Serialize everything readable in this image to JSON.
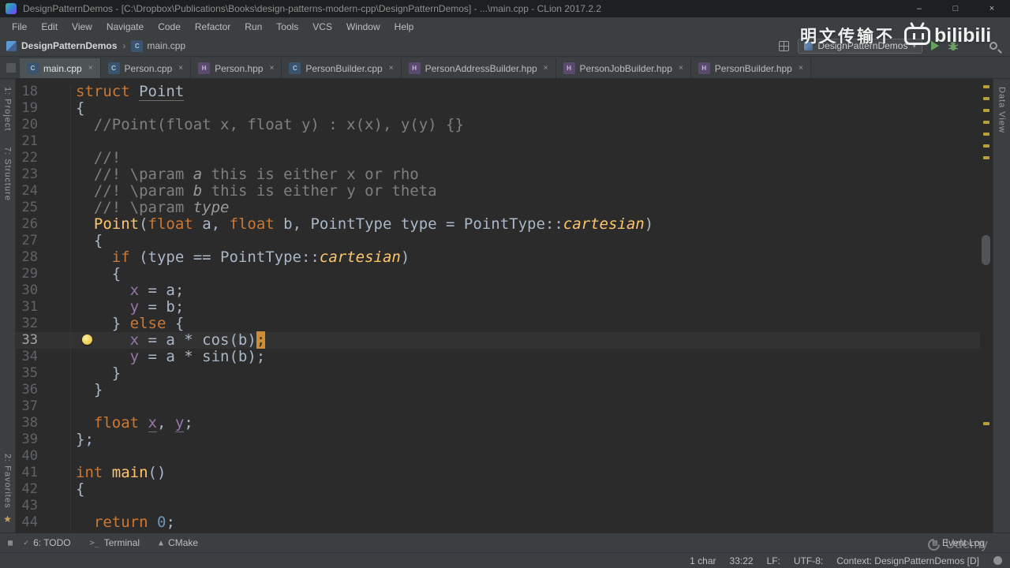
{
  "window": {
    "title": "DesignPatternDemos - [C:\\Dropbox\\Publications\\Books\\design-patterns-modern-cpp\\DesignPatternDemos] - ...\\main.cpp - CLion 2017.2.2",
    "controls": {
      "minimize": "–",
      "maximize": "□",
      "close": "×"
    }
  },
  "menu": [
    "File",
    "Edit",
    "View",
    "Navigate",
    "Code",
    "Refactor",
    "Run",
    "Tools",
    "VCS",
    "Window",
    "Help"
  ],
  "breadcrumb": {
    "project": "DesignPatternDemos",
    "file": "main.cpp"
  },
  "toolbar": {
    "run_config": "DesignPatternDemos"
  },
  "glyphs": {
    "close": "×",
    "chevron": "▾",
    "breadcrumb_sep": "›",
    "star": "★",
    "event": "▤",
    "toggler": "▦"
  },
  "file_icon_glyphs": {
    "cpp": "C",
    "hpp": "H"
  },
  "tabs": [
    {
      "label": "main.cpp",
      "kind": "cpp",
      "active": true
    },
    {
      "label": "Person.cpp",
      "kind": "cpp"
    },
    {
      "label": "Person.hpp",
      "kind": "hpp"
    },
    {
      "label": "PersonBuilder.cpp",
      "kind": "cpp"
    },
    {
      "label": "PersonAddressBuilder.hpp",
      "kind": "hpp"
    },
    {
      "label": "PersonJobBuilder.hpp",
      "kind": "hpp"
    },
    {
      "label": "PersonBuilder.hpp",
      "kind": "hpp"
    }
  ],
  "stripes": {
    "left_top": [
      "1: Project",
      "7: Structure"
    ],
    "left_bottom": [
      "2: Favorites"
    ],
    "right": [
      "Data View"
    ]
  },
  "editor": {
    "caret_line": 33,
    "error_stripe_marks": [
      8,
      23,
      38,
      53,
      68,
      83,
      98,
      435
    ],
    "lines": [
      {
        "no": 18,
        "tokens": [
          [
            "kw",
            "struct"
          ],
          [
            "pl",
            " "
          ],
          [
            "clsu",
            "Point"
          ]
        ]
      },
      {
        "no": 19,
        "tokens": [
          [
            "pl",
            "{"
          ]
        ]
      },
      {
        "no": 20,
        "tokens": [
          [
            "pl",
            "  "
          ],
          [
            "cm",
            "//Point(float x, float y) : x(x), y(y) {}"
          ]
        ]
      },
      {
        "no": 21,
        "tokens": []
      },
      {
        "no": 22,
        "tokens": [
          [
            "pl",
            "  "
          ],
          [
            "cm",
            "//!"
          ]
        ]
      },
      {
        "no": 23,
        "tokens": [
          [
            "pl",
            "  "
          ],
          [
            "cm",
            "//! \\param "
          ],
          [
            "cmi",
            "a"
          ],
          [
            "cm",
            " this is either x or rho"
          ]
        ]
      },
      {
        "no": 24,
        "tokens": [
          [
            "pl",
            "  "
          ],
          [
            "cm",
            "//! \\param "
          ],
          [
            "cmi",
            "b"
          ],
          [
            "cm",
            " this is either y or theta"
          ]
        ]
      },
      {
        "no": 25,
        "tokens": [
          [
            "pl",
            "  "
          ],
          [
            "cm",
            "//! \\param "
          ],
          [
            "cmi",
            "type"
          ]
        ]
      },
      {
        "no": 26,
        "tokens": [
          [
            "pl",
            "  "
          ],
          [
            "fn",
            "Point"
          ],
          [
            "pl",
            "("
          ],
          [
            "kw",
            "float"
          ],
          [
            "pl",
            " a, "
          ],
          [
            "kw",
            "float"
          ],
          [
            "pl",
            " b, PointType type = PointType::"
          ],
          [
            "cst",
            "cartesian"
          ],
          [
            "pl",
            ")"
          ]
        ]
      },
      {
        "no": 27,
        "tokens": [
          [
            "pl",
            "  {"
          ]
        ]
      },
      {
        "no": 28,
        "tokens": [
          [
            "pl",
            "    "
          ],
          [
            "kw",
            "if"
          ],
          [
            "pl",
            " (type == PointType::"
          ],
          [
            "cst",
            "cartesian"
          ],
          [
            "pl",
            ")"
          ]
        ]
      },
      {
        "no": 29,
        "tokens": [
          [
            "pl",
            "    {"
          ]
        ]
      },
      {
        "no": 30,
        "tokens": [
          [
            "pl",
            "      "
          ],
          [
            "fld",
            "x"
          ],
          [
            "pl",
            " = a;"
          ]
        ]
      },
      {
        "no": 31,
        "tokens": [
          [
            "pl",
            "      "
          ],
          [
            "fld",
            "y"
          ],
          [
            "pl",
            " = b;"
          ]
        ]
      },
      {
        "no": 32,
        "tokens": [
          [
            "pl",
            "    } "
          ],
          [
            "kw",
            "else"
          ],
          [
            "pl",
            " {"
          ]
        ]
      },
      {
        "no": 33,
        "tokens": [
          [
            "pl",
            "      "
          ],
          [
            "fld",
            "x"
          ],
          [
            "pl",
            " = a * cos(b)"
          ],
          [
            "crt",
            ";"
          ]
        ]
      },
      {
        "no": 34,
        "tokens": [
          [
            "pl",
            "      "
          ],
          [
            "fld",
            "y"
          ],
          [
            "pl",
            " = a * sin(b);"
          ]
        ]
      },
      {
        "no": 35,
        "tokens": [
          [
            "pl",
            "    }"
          ]
        ]
      },
      {
        "no": 36,
        "tokens": [
          [
            "pl",
            "  }"
          ]
        ]
      },
      {
        "no": 37,
        "tokens": []
      },
      {
        "no": 38,
        "tokens": [
          [
            "pl",
            "  "
          ],
          [
            "kw",
            "float"
          ],
          [
            "pl",
            " "
          ],
          [
            "fldu",
            "x"
          ],
          [
            "pl",
            ", "
          ],
          [
            "fldu",
            "y"
          ],
          [
            "pl",
            ";"
          ]
        ]
      },
      {
        "no": 39,
        "tokens": [
          [
            "pl",
            "};"
          ]
        ]
      },
      {
        "no": 40,
        "tokens": []
      },
      {
        "no": 41,
        "tokens": [
          [
            "kw",
            "int"
          ],
          [
            "pl",
            " "
          ],
          [
            "fn",
            "main"
          ],
          [
            "pl",
            "()"
          ]
        ]
      },
      {
        "no": 42,
        "tokens": [
          [
            "pl",
            "{"
          ]
        ]
      },
      {
        "no": 43,
        "tokens": []
      },
      {
        "no": 44,
        "tokens": [
          [
            "pl",
            "  "
          ],
          [
            "kw",
            "return"
          ],
          [
            "pl",
            " "
          ],
          [
            "num",
            "0"
          ],
          [
            "pl",
            ";"
          ]
        ]
      }
    ]
  },
  "tool_buttons": [
    {
      "label": "6: TODO",
      "glyph": "✓"
    },
    {
      "label": "Terminal",
      "glyph": ">_"
    },
    {
      "label": "CMake",
      "glyph": "▲"
    }
  ],
  "bottom": {
    "event_log": "Event Log"
  },
  "status_bar": {
    "items": [
      "1 char",
      "33:22",
      "LF:",
      "UTF-8:",
      "Context: DesignPatternDemos [D]"
    ]
  },
  "watermarks": {
    "bilibili_text": "明文传输不",
    "bilibili_brand": "bilibili",
    "udemy": "Udemy"
  },
  "colors": {
    "editor_bg": "#2b2b2b",
    "ui_bg": "#3c3f41",
    "keyword": "#cc7832",
    "plain_text": "#a9b7c6",
    "comment": "#7f7f7f",
    "function": "#ffc66d",
    "field": "#9876aa",
    "number": "#6897bb",
    "line_number": "#606366",
    "caret_highlight": "#cf8e36",
    "line_highlight": "#323232",
    "run_green": "#65a35e",
    "warning_mark": "#b8a038"
  }
}
